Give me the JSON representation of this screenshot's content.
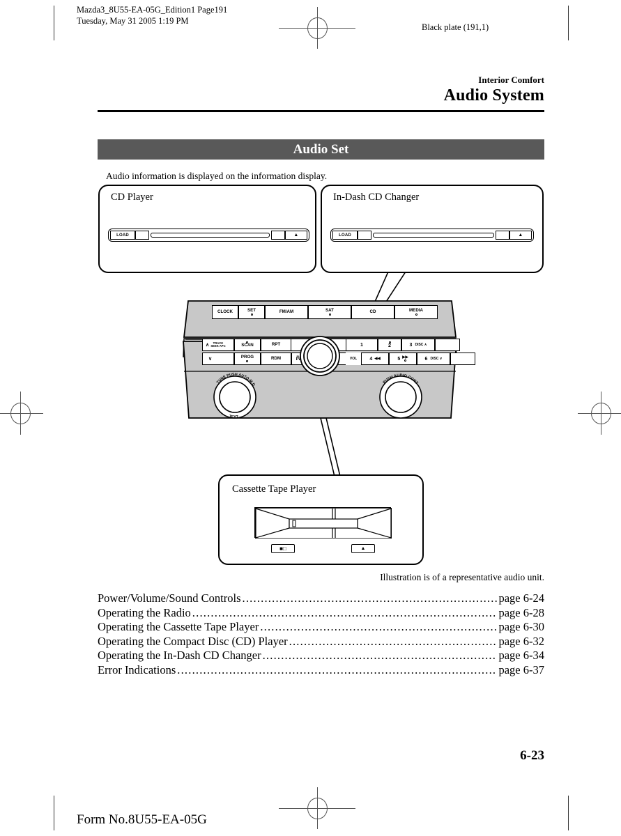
{
  "print_marks": {
    "header_meta": "Mazda3_8U55-EA-05G_Edition1 Page191\nTuesday, May 31 2005 1:19 PM",
    "black_plate": "Black plate (191,1)"
  },
  "chapter": {
    "kicker": "Interior Comfort",
    "title": "Audio System"
  },
  "section": {
    "bar_title": "Audio Set",
    "intro": "Audio information is displayed on the information display."
  },
  "callouts": {
    "cd_player": {
      "label": "CD Player",
      "load_button": "LOAD",
      "eject_icon": "▲"
    },
    "cd_changer": {
      "label": "In-Dash CD Changer",
      "load_button": "LOAD",
      "eject_icon": "▲"
    },
    "cassette": {
      "label": "Cassette Tape Player",
      "dolby_icon": "■□",
      "eject_icon": "▲"
    }
  },
  "audio_unit": {
    "top_buttons": [
      {
        "label": "CLOCK",
        "has_dot": false
      },
      {
        "label": "SET",
        "has_dot": true
      },
      {
        "label": "FM/AM",
        "has_dot": false
      },
      {
        "label": "SAT",
        "has_dot": true
      },
      {
        "label": "CD",
        "has_dot": false
      },
      {
        "label": "MEDIA",
        "has_dot": true
      }
    ],
    "upper_row": [
      {
        "label": "∧",
        "sub1": "TRACK",
        "sub2": "SEEK APC",
        "has_dot": false
      },
      {
        "label": "SCAN",
        "has_dot": true
      },
      {
        "label": "RPT",
        "has_dot": false
      },
      {
        "label": "1",
        "has_dot": false
      },
      {
        "label": "2",
        "has_dot": true
      },
      {
        "label": "3",
        "sub1": "DISC ∧",
        "has_dot": false
      }
    ],
    "lower_row": [
      {
        "label": "∨",
        "has_dot": false
      },
      {
        "label": "PROG",
        "has_dot": true
      },
      {
        "label": "RDM",
        "has_dot": false
      },
      {
        "label": "PWR",
        "sub1": "PUSH",
        "has_dot": false
      },
      {
        "label": "VOL",
        "has_dot": false
      },
      {
        "label": "4",
        "sub1": "◀◀",
        "has_dot": false
      },
      {
        "label": "5",
        "sub1": "▶▶",
        "has_dot": true
      },
      {
        "label": "6",
        "sub1": "DISC ∨",
        "has_dot": false
      }
    ],
    "left_knob": {
      "arc_top": "TUNE  PUSH  AUTO-M  DISC/FILE",
      "arc_bottom": "TEXT"
    },
    "right_knob": {
      "arc_top": "PUSH AUDIO CONT"
    }
  },
  "illustration_note": "Illustration is of a representative audio unit.",
  "toc": {
    "entries": [
      {
        "title": "Power/Volume/Sound Controls",
        "page": "page 6-24"
      },
      {
        "title": "Operating the Radio",
        "page": "page 6-28"
      },
      {
        "title": "Operating the Cassette Tape Player",
        "page": "page 6-30"
      },
      {
        "title": "Operating the Compact Disc (CD) Player",
        "page": "page 6-32"
      },
      {
        "title": "Operating the In-Dash CD Changer",
        "page": "page 6-34"
      },
      {
        "title": "Error Indications",
        "page": "page 6-37"
      }
    ],
    "dots": "...................................................................................................................................."
  },
  "footer": {
    "folio": "6-23",
    "form_number": "Form No.8U55-EA-05G"
  },
  "colors": {
    "section_bar": "#595959",
    "unit_face": "#c8c8c8",
    "ink": "#000000"
  }
}
